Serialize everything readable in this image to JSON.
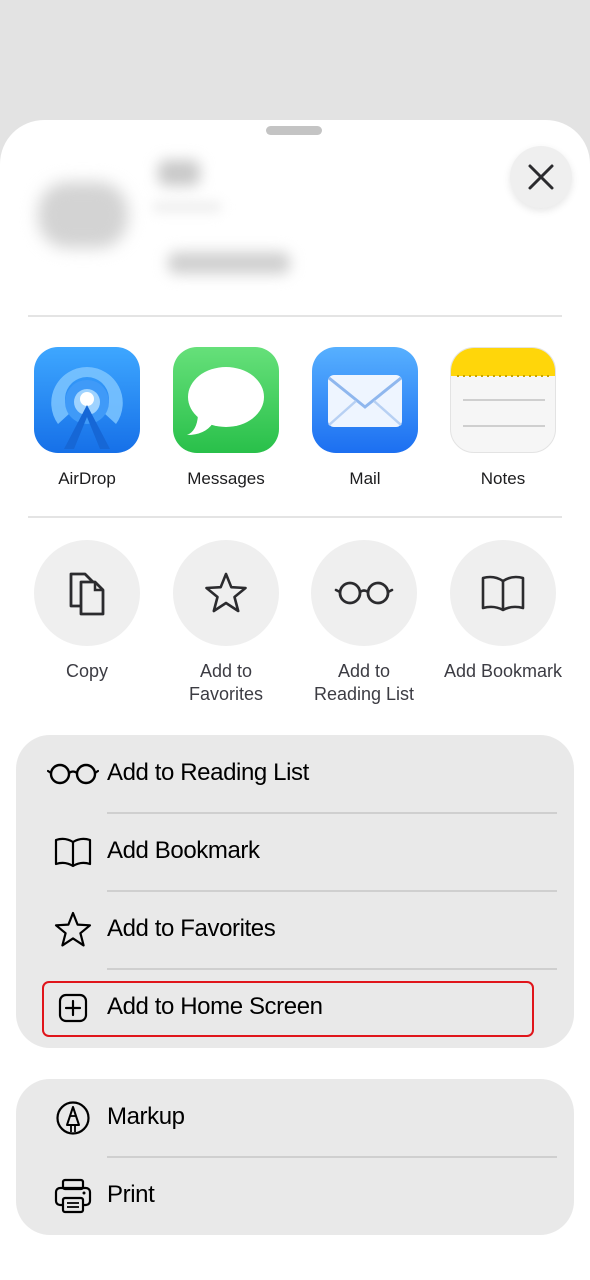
{
  "share_sheet": {
    "close_icon": "xmark-icon",
    "apps": [
      {
        "label": "AirDrop",
        "icon": "airdrop-icon",
        "color": "#1a7cf0"
      },
      {
        "label": "Messages",
        "icon": "messages-icon",
        "color": "#34c759"
      },
      {
        "label": "Mail",
        "icon": "mail-icon",
        "color": "#2a84f8"
      },
      {
        "label": "Notes",
        "icon": "notes-icon",
        "color": "#ffd60a"
      }
    ],
    "actions": [
      {
        "label": "Copy",
        "icon": "copy-icon"
      },
      {
        "label": "Add to Favorites",
        "icon": "star-icon"
      },
      {
        "label": "Add to Reading List",
        "icon": "glasses-icon"
      },
      {
        "label": "Add Bookmark",
        "icon": "book-icon"
      }
    ],
    "menu_group_1": [
      {
        "label": "Add to Reading List",
        "icon": "glasses-icon"
      },
      {
        "label": "Add Bookmark",
        "icon": "book-icon"
      },
      {
        "label": "Add to Favorites",
        "icon": "star-icon"
      },
      {
        "label": "Add to Home Screen",
        "icon": "plus-square-icon",
        "highlighted": true
      }
    ],
    "menu_group_2": [
      {
        "label": "Markup",
        "icon": "markup-pen-icon"
      },
      {
        "label": "Print",
        "icon": "printer-icon"
      }
    ],
    "highlight_color": "#e0151b"
  }
}
